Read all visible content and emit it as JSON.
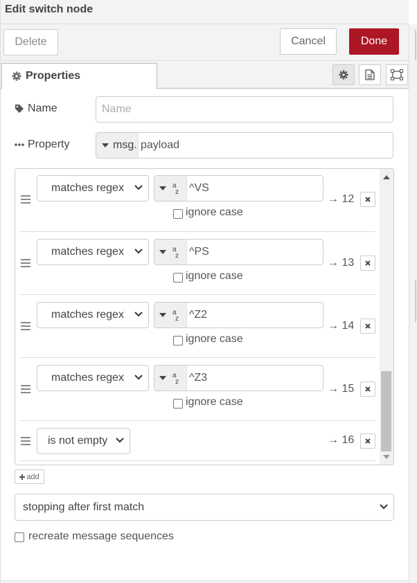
{
  "tray": {
    "title": "Edit switch node"
  },
  "toolbar": {
    "delete_label": "Delete",
    "cancel_label": "Cancel",
    "done_label": "Done"
  },
  "tabs": {
    "properties_label": "Properties"
  },
  "form": {
    "name_label": "Name",
    "name_placeholder": "Name",
    "name_value": "",
    "property_label": "Property",
    "property_type": "msg.",
    "property_value": "payload"
  },
  "rules": [
    {
      "operator": "matches regex",
      "value": "^VS",
      "ignore_case_label": "ignore case",
      "ignore_case": false,
      "output": "→ 12"
    },
    {
      "operator": "matches regex",
      "value": "^PS",
      "ignore_case_label": "ignore case",
      "ignore_case": false,
      "output": "→ 13"
    },
    {
      "operator": "matches regex",
      "value": "^Z2",
      "ignore_case_label": "ignore case",
      "ignore_case": false,
      "output": "→ 14"
    },
    {
      "operator": "matches regex",
      "value": "^Z3",
      "ignore_case_label": "ignore case",
      "ignore_case": false,
      "output": "→ 15"
    },
    {
      "operator": "is not empty",
      "output": "→ 16"
    }
  ],
  "add_label": "add",
  "checking_mode": "stopping after first match",
  "recreate_label": "recreate message sequences",
  "recreate_checked": false,
  "colors": {
    "done": "#ad1625",
    "border": "#cccccc",
    "background": "#f3f3f3"
  },
  "icons": [
    "gear-icon",
    "description-icon",
    "appearance-icon",
    "tag-icon",
    "ellipsis-icon",
    "drag-handle-icon",
    "chevron-down-icon",
    "close-icon",
    "plus-icon",
    "caret-down-icon",
    "string-type-icon"
  ]
}
